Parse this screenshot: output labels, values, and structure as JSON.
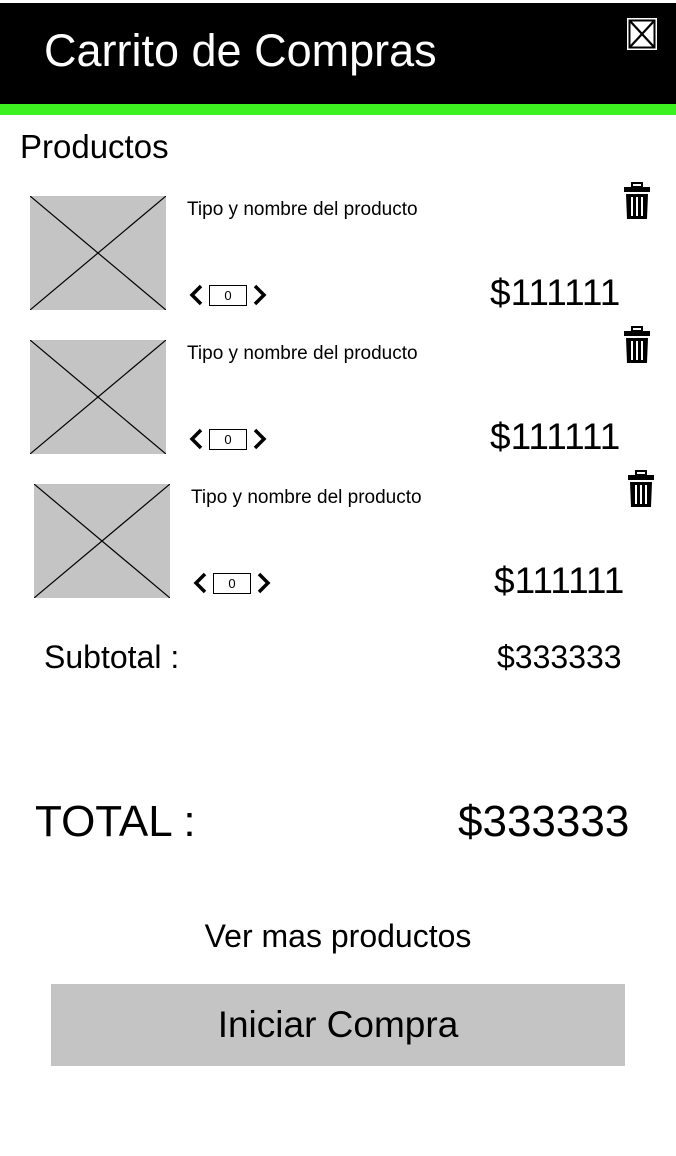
{
  "header": {
    "title": "Carrito de Compras",
    "close_icon": "close-box-icon",
    "background_color": "#000000",
    "accent_color": "#3cf11f"
  },
  "products_section": {
    "title": "Productos"
  },
  "products": [
    {
      "name": "Tipo y nombre del producto",
      "quantity": "0",
      "price": "$111111"
    },
    {
      "name": "Tipo y nombre del producto",
      "quantity": "0",
      "price": "$111111"
    },
    {
      "name": "Tipo y nombre del producto",
      "quantity": "0",
      "price": "$111111"
    }
  ],
  "summary": {
    "subtotal_label": "Subtotal :",
    "subtotal_value": "$333333",
    "total_label": "TOTAL :",
    "total_value": "$333333"
  },
  "actions": {
    "more_products_label": "Ver mas productos",
    "checkout_label": "Iniciar Compra"
  },
  "icons": {
    "image_placeholder": "image-placeholder-icon",
    "delete": "trash-icon",
    "decrease": "chevron-left-icon",
    "increase": "chevron-right-icon"
  }
}
